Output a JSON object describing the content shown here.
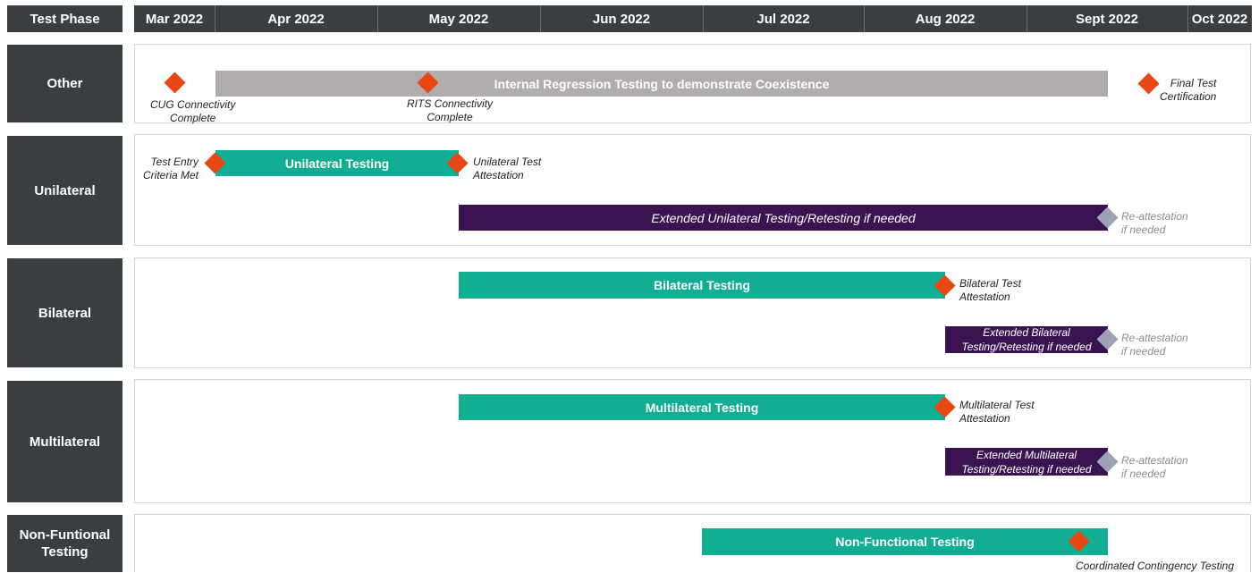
{
  "header": {
    "phase_label": "Test Phase",
    "months": [
      "Mar 2022",
      "Apr 2022",
      "May 2022",
      "Jun 2022",
      "Jul 2022",
      "Aug 2022",
      "Sept 2022",
      "Oct 2022"
    ]
  },
  "rows": {
    "other": {
      "label": "Other",
      "bar_regression": "Internal Regression Testing to demonstrate Coexistence",
      "ms_cug": "CUG Connectivity\nComplete",
      "ms_rits": "RITS Connectivity\nComplete",
      "ms_final": "Final Test\nCertification"
    },
    "unilateral": {
      "label": "Unilateral",
      "ms_entry": "Test Entry\nCriteria Met",
      "bar_testing": "Unilateral Testing",
      "ms_attestation": "Unilateral Test\nAttestation",
      "bar_extended": "Extended Unilateral Testing/Retesting if needed",
      "ms_reattestation": "Re-attestation\nif needed"
    },
    "bilateral": {
      "label": "Bilateral",
      "bar_testing": "Bilateral Testing",
      "ms_attestation": "Bilateral Test\nAttestation",
      "bar_extended": "Extended Bilateral\nTesting/Retesting if needed",
      "ms_reattestation": "Re-attestation\nif needed"
    },
    "multilateral": {
      "label": "Multilateral",
      "bar_testing": "Multilateral Testing",
      "ms_attestation": "Multilateral Test\nAttestation",
      "bar_extended": "Extended Multilateral\nTesting/Retesting if needed",
      "ms_reattestation": "Re-attestation\nif needed"
    },
    "nonfunctional": {
      "label": "Non-Funtional\nTesting",
      "bar_testing": "Non-Functional Testing",
      "ms_contingency": "Coordinated Contingency Testing"
    }
  },
  "colors": {
    "header": "#3b3e40",
    "teal": "#11ae94",
    "purple": "#3a1450",
    "gray_bar": "#b1adad",
    "milestone": "#e84712",
    "optional_milestone": "#9ca3b9"
  }
}
